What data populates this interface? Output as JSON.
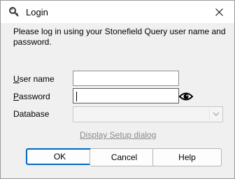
{
  "window": {
    "title": "Login"
  },
  "message": "Please log in using your Stonefield Query user name and password.",
  "fields": {
    "user_name": {
      "label_mnemonic": "U",
      "label_rest": "ser name",
      "value": ""
    },
    "password": {
      "label_mnemonic": "P",
      "label_rest": "assword",
      "value": ""
    },
    "database": {
      "label": "Database",
      "value": ""
    }
  },
  "link": "Display Setup dialog",
  "buttons": {
    "ok": "OK",
    "cancel": "Cancel",
    "help": "Help"
  },
  "icons": {
    "title": "key-icon",
    "close": "close-icon",
    "password_toggle": "eye-icon",
    "dropdown": "chevron-down-icon"
  },
  "colors": {
    "accent": "#0067c0",
    "link": "#8a8a8a"
  }
}
